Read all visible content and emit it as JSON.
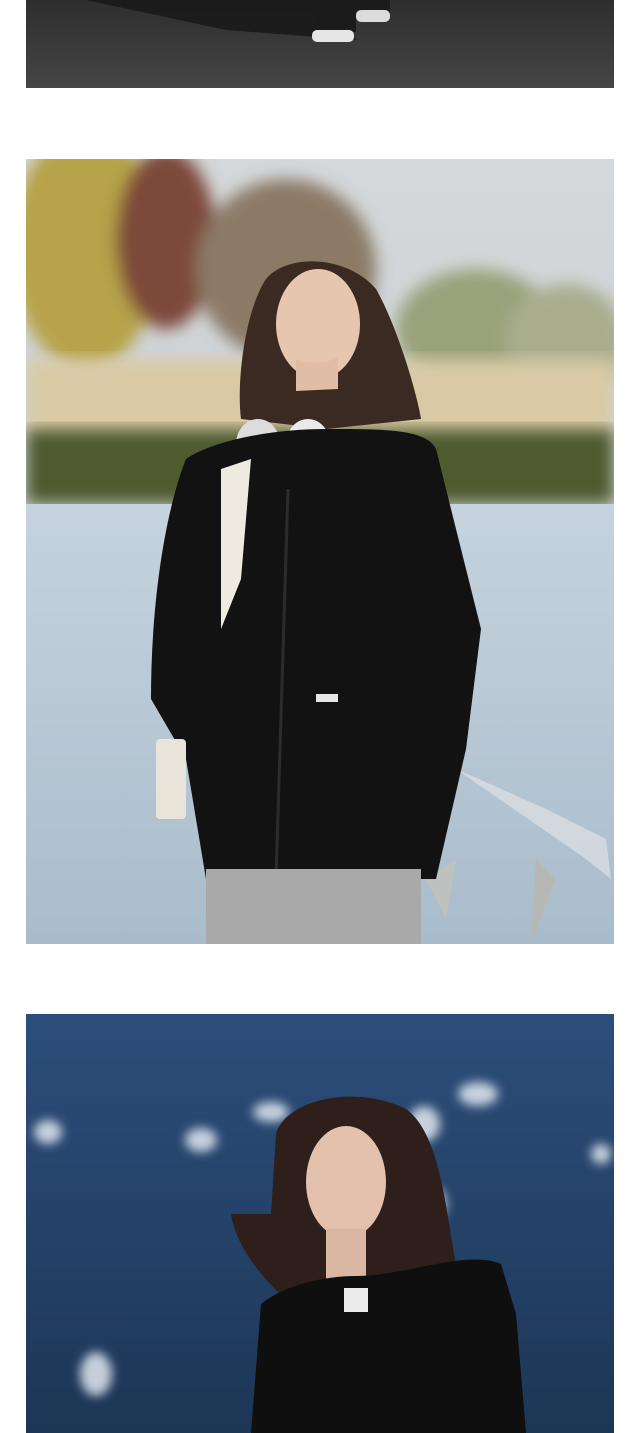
{
  "page": {
    "background": "#ffffff"
  },
  "photos": [
    {
      "subject": "pavement-with-sneakers",
      "colors": {
        "ground": "#3a3a3a",
        "shadow": "#1a1a1a",
        "shoe": "#e8e8e8"
      }
    },
    {
      "subject": "woman-black-hoodie-lakeside",
      "colors": {
        "sky": "#c9cfd2",
        "trees": "#b5a04a",
        "reeds": "#d8c9a4",
        "water": "#b9c9d6",
        "hoodie": "#121212",
        "pants": "#a9a9a9",
        "bag": "#e9e4da",
        "hair": "#3b2a22",
        "skin": "#e7c6b0"
      }
    },
    {
      "subject": "woman-windblown-hair-blue-water",
      "colors": {
        "water": "#2d4f7c",
        "water_dark": "#1c3558",
        "gulls": "#dfe6ef",
        "hoodie": "#0f0f10",
        "hair": "#2e1f1a",
        "skin": "#e3c1ad"
      }
    }
  ]
}
